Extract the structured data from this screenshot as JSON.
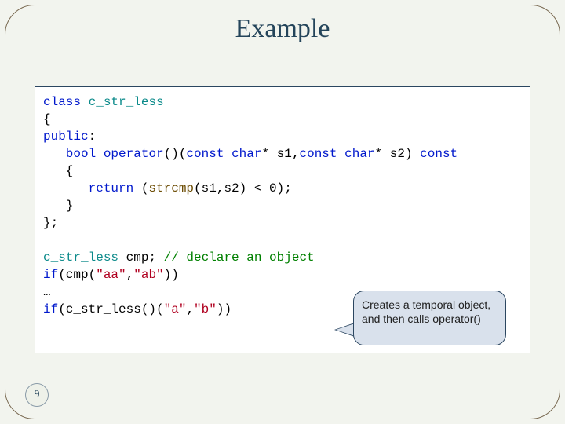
{
  "slide": {
    "title": "Example",
    "page_number": "9"
  },
  "code": {
    "l1a": "class",
    "l1b": " c_str_less",
    "l2": "{",
    "l3a": "public",
    "l3b": ":",
    "l4a": "   bool",
    "l4b": " ",
    "l4c": "operator",
    "l4d": "()(",
    "l4e": "const",
    "l4f": " ",
    "l4g": "char",
    "l4h": "* s1,",
    "l4i": "const",
    "l4j": " ",
    "l4k": "char",
    "l4l": "* s2) ",
    "l4m": "const",
    "l5": "   {",
    "l6a": "      return",
    "l6b": " (",
    "l6c": "strcmp",
    "l6d": "(s1,s2) < 0);",
    "l7": "   }",
    "l8": "};",
    "blank": " ",
    "l10a": "c_str_less",
    "l10b": " cmp; ",
    "l10c": "// declare an object",
    "l11a": "if",
    "l11b": "(cmp(",
    "l11c": "\"aa\"",
    "l11d": ",",
    "l11e": "\"ab\"",
    "l11f": "))",
    "l12": "…",
    "l13a": "if",
    "l13b": "(c_str_less()(",
    "l13c": "\"a\"",
    "l13d": ",",
    "l13e": "\"b\"",
    "l13f": "))"
  },
  "callout": {
    "text": "Creates a temporal object, and then calls operator()"
  }
}
